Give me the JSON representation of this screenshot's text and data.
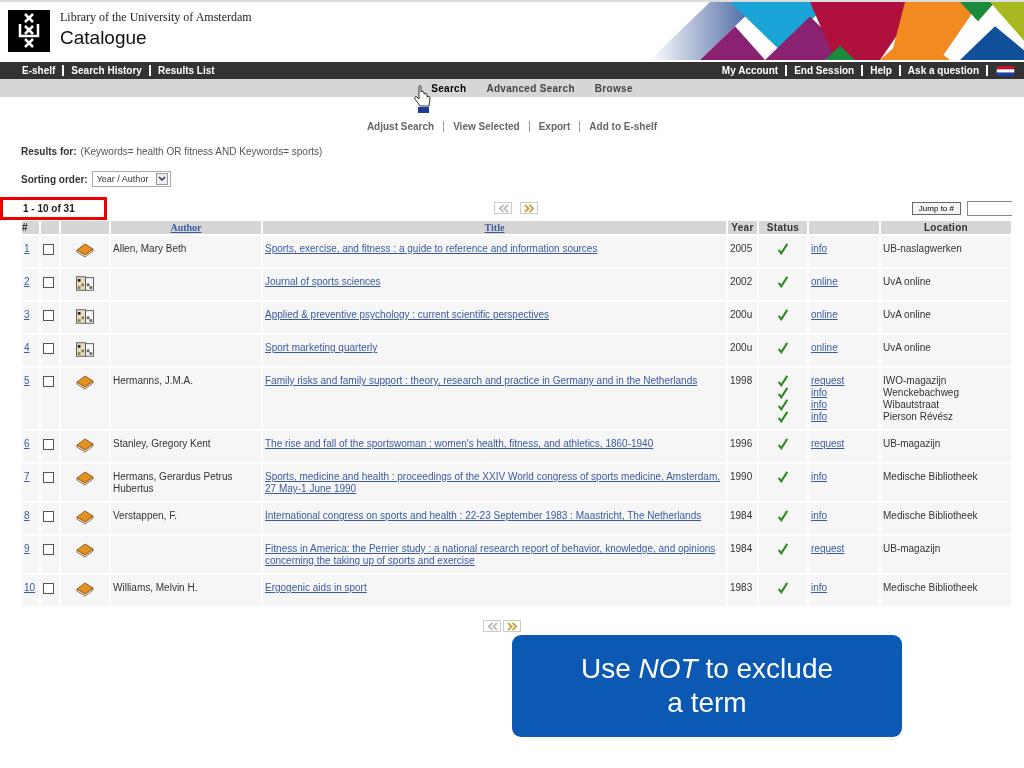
{
  "header": {
    "subtitle": "Library of the University of Amsterdam",
    "title": "Catalogue"
  },
  "top_nav": {
    "left": [
      "E-shelf",
      "Search History",
      "Results List"
    ],
    "right": [
      "My Account",
      "End Session",
      "Help",
      "Ask a question"
    ]
  },
  "search_tabs": [
    {
      "label": "Search",
      "selected": true
    },
    {
      "label": "Advanced Search",
      "selected": false
    },
    {
      "label": "Browse",
      "selected": false
    }
  ],
  "actions": [
    "Adjust Search",
    "View Selected",
    "Export",
    "Add to E-shelf"
  ],
  "results_for": {
    "label": "Results for:",
    "query": "(Keywords= health OR fitness AND Keywords= sports)"
  },
  "sorting": {
    "label": "Sorting order:",
    "value": "Year / Author"
  },
  "range": "1 - 10 of 31",
  "pager": {
    "prev_disabled": true,
    "next_disabled": false
  },
  "jump": {
    "button": "Jump to #"
  },
  "table": {
    "columns": [
      "#",
      "",
      "",
      "Author",
      "Title",
      "Year",
      "Status",
      "",
      "Location"
    ],
    "rows": [
      {
        "number": "1",
        "checked": false,
        "kind": "book",
        "author": "Allen, Mary Beth",
        "title": "Sports, exercise, and fitness : a guide to reference and information sources",
        "year": "2005",
        "holdings": [
          {
            "link": "info",
            "location": "UB-naslagwerken"
          }
        ]
      },
      {
        "number": "2",
        "checked": false,
        "kind": "journal",
        "title": "Journal of sports sciences",
        "year": "2002",
        "holdings": [
          {
            "link": "online",
            "location": "UvA online"
          }
        ]
      },
      {
        "number": "3",
        "checked": false,
        "kind": "journal",
        "title": "Applied & preventive psychology : current scientific perspectives",
        "year": "200u",
        "holdings": [
          {
            "link": "online",
            "location": "UvA online"
          }
        ]
      },
      {
        "number": "4",
        "checked": false,
        "kind": "journal",
        "title": "Sport marketing quarterly",
        "year": "200u",
        "holdings": [
          {
            "link": "online",
            "location": "UvA online"
          }
        ]
      },
      {
        "number": "5",
        "checked": false,
        "kind": "book",
        "author": "Hermanns, J.M.A.",
        "title": "Family risks and family support : theory, research and practice in Germany and in the Netherlands",
        "year": "1998",
        "holdings": [
          {
            "link": "request",
            "location": "IWO-magazijn"
          },
          {
            "link": "info",
            "location": "Wenckebachweg"
          },
          {
            "link": "info",
            "location": "Wibautstraat"
          },
          {
            "link": "info",
            "location": "Pierson Révész"
          }
        ]
      },
      {
        "number": "6",
        "checked": false,
        "kind": "book",
        "author": "Stanley, Gregory Kent",
        "title": "The rise and fall of the sportswoman : women's health, fitness, and athletics, 1860-1940",
        "year": "1996",
        "holdings": [
          {
            "link": "request",
            "location": "UB-magazijn"
          }
        ]
      },
      {
        "number": "7",
        "checked": false,
        "kind": "book",
        "author": "Hermans, Gerardus Petrus Hubertus",
        "title": "Sports, medicine and health : proceedings of the XXIV World congress of sports medicine, Amsterdam, 27 May-1 June 1990",
        "year": "1990",
        "holdings": [
          {
            "link": "info",
            "location": "Medische Bibliotheek"
          }
        ]
      },
      {
        "number": "8",
        "checked": false,
        "kind": "book",
        "author": "Verstappen, F.",
        "title": "International congress on sports and health : 22-23 September 1983 : Maastricht, The Netherlands",
        "year": "1984",
        "holdings": [
          {
            "link": "info",
            "location": "Medische Bibliotheek"
          }
        ]
      },
      {
        "number": "9",
        "checked": false,
        "kind": "book",
        "title": "Fitness in America: the Perrier study : a national research report of behavior, knowledge, and opinions concerning the taking up of sports and exercise",
        "year": "1984",
        "holdings": [
          {
            "link": "request",
            "location": "UB-magazijn"
          }
        ]
      },
      {
        "number": "10",
        "checked": false,
        "kind": "book",
        "author": "Williams, Melvin H.",
        "title": "Ergogenic aids in sport",
        "year": "1983",
        "holdings": [
          {
            "link": "info",
            "location": "Medische Bibliotheek"
          }
        ]
      }
    ]
  },
  "callout": "Use *NOT* to exclude a term"
}
